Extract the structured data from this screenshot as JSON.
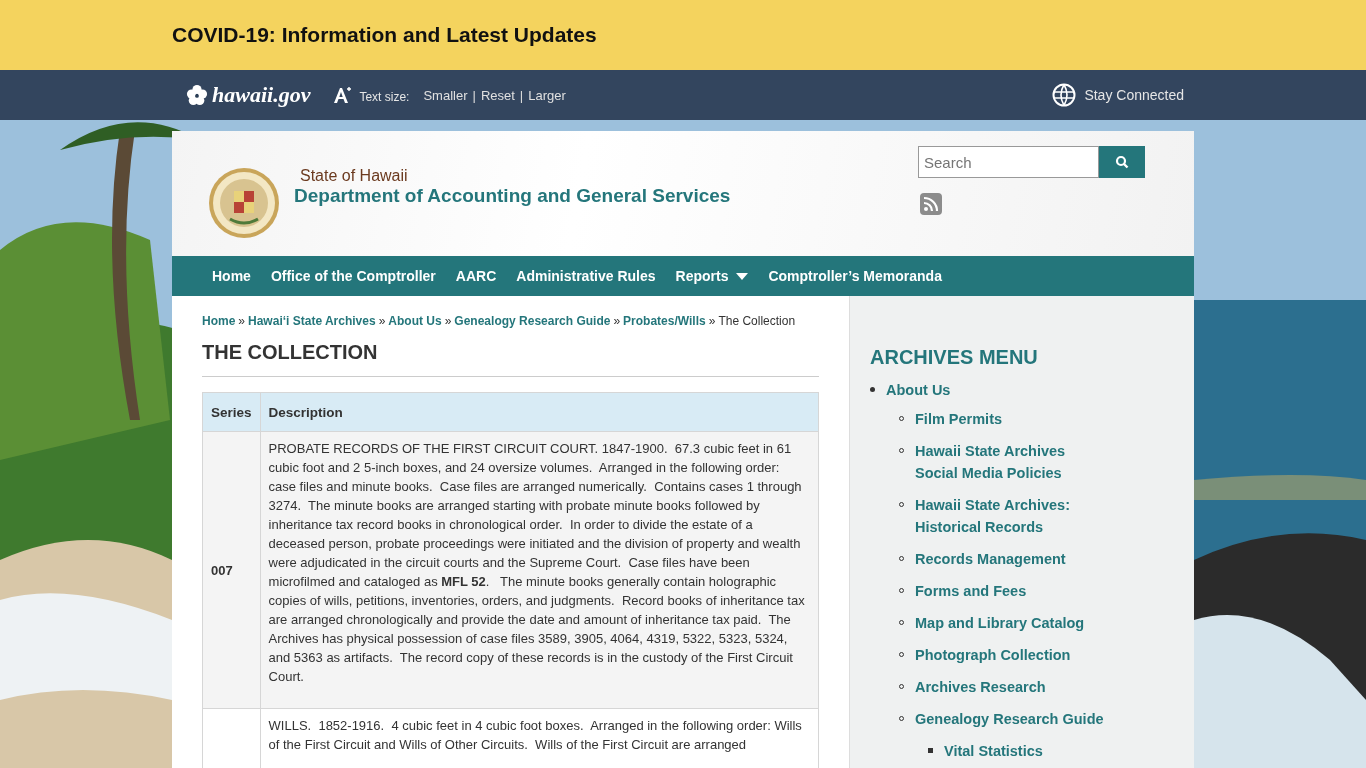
{
  "alert_bar": {
    "title": "COVID-19: Information and Latest Updates"
  },
  "top_bar": {
    "logo": "hawaii.gov",
    "text_size_label": "Text size:",
    "text_size_links": [
      "Smaller",
      "Reset",
      "Larger"
    ],
    "separator": "|",
    "stay_connected": "Stay Connected"
  },
  "header": {
    "state": "State of Hawaii",
    "department": "Department of Accounting and General Services",
    "search": {
      "placeholder": "Search"
    }
  },
  "nav": [
    {
      "label": "Home",
      "dropdown": false
    },
    {
      "label": "Office of the Comptroller",
      "dropdown": false
    },
    {
      "label": "AARC",
      "dropdown": false
    },
    {
      "label": "Administrative Rules",
      "dropdown": false
    },
    {
      "label": "Reports",
      "dropdown": true
    },
    {
      "label": "Comptroller’s Memoranda",
      "dropdown": false
    }
  ],
  "breadcrumb": {
    "links": [
      "Home",
      "Hawai‘i State Archives",
      "About Us",
      "Genealogy Research Guide",
      "Probates/Wills"
    ],
    "separator": "»",
    "current": "The Collection"
  },
  "page_title": "THE COLLECTION",
  "table": {
    "columns": [
      "Series",
      "Description"
    ],
    "rows": [
      {
        "series": "007",
        "description": "PROBATE RECORDS OF THE FIRST CIRCUIT COURT. 1847-1900.  67.3 cubic feet in 61 cubic foot and 2 5-inch boxes, and 24 oversize volumes.  Arranged in the following order: case files and minute books.  Case files are arranged numerically.  Contains cases 1 through 3274.  The minute books are arranged starting with probate minute books followed by inheritance tax record books in chronological order.  In order to divide the estate of a deceased person, probate proceedings were initiated and the division of property and wealth were adjudicated in the circuit courts and the Supreme Court.  Case files have been microfilmed and cataloged as **MFL 52**.   The minute books generally contain holographic copies of wills, petitions, inventories, orders, and judgments.  Record books of inheritance tax are arranged chronologically and provide the date and amount of inheritance tax paid.  The Archives has physical possession of case files 3589, 3905, 4064, 4319, 5322, 5323, 5324, and 5363 as artifacts.  The record copy of these records is in the custody of the First Circuit Court."
      },
      {
        "description": "WILLS.  1852-1916.  4 cubic feet in 4 cubic foot boxes.  Arranged in the following order: Wills of the First Circuit and Wills of Other Circuits.  Wills of the First Circuit are arranged"
      }
    ]
  },
  "sidebar": {
    "title": "ARCHIVES MENU",
    "items": [
      {
        "label": "About Us",
        "children": [
          {
            "label": "Film Permits"
          },
          {
            "label": "Hawaii State Archives Social Media Policies"
          },
          {
            "label": "Hawaii State Archives: Historical Records"
          },
          {
            "label": "Records Management"
          },
          {
            "label": "Forms and Fees"
          },
          {
            "label": "Map and Library Catalog"
          },
          {
            "label": "Photograph Collection"
          },
          {
            "label": "Archives Research"
          },
          {
            "label": "Genealogy Research Guide",
            "children": [
              {
                "label": "Vital Statistics"
              }
            ]
          }
        ]
      }
    ]
  }
}
